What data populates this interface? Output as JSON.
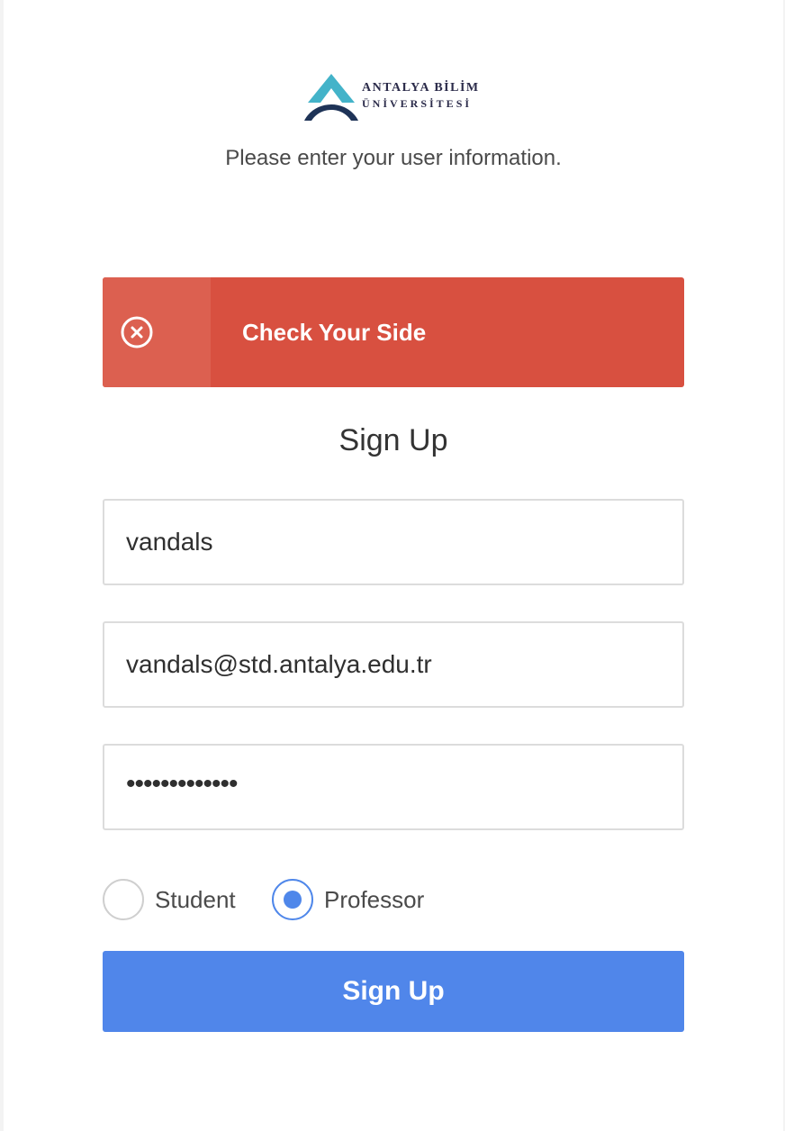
{
  "brand": {
    "line1": "ANTALYA BİLİM",
    "line2": "ÜNİVERSİTESİ",
    "colors": {
      "light": "#43b3c9",
      "dark": "#1e3357"
    }
  },
  "subtitle": "Please enter your user information.",
  "alert": {
    "icon": "close-circle-icon",
    "message": "Check Your Side",
    "color": "#d85040"
  },
  "form": {
    "heading": "Sign Up",
    "username": "vandals",
    "email": "vandals@std.antalya.edu.tr",
    "password_masked": "•••••••••••••",
    "role": {
      "options": [
        "Student",
        "Professor"
      ],
      "selected": "Professor"
    },
    "submit_label": "Sign Up",
    "accent_color": "#5086ea"
  }
}
